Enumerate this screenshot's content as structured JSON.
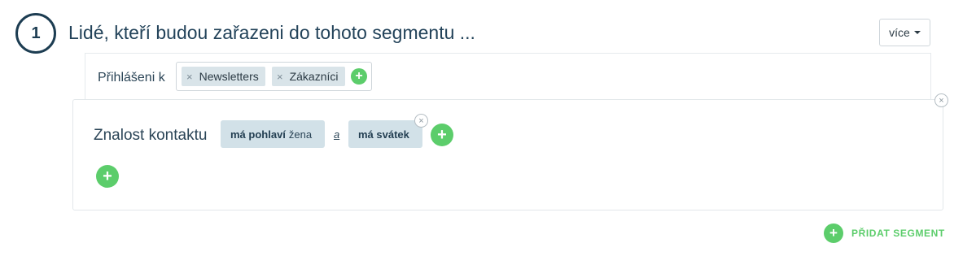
{
  "step": {
    "number": "1",
    "title": "Lidé, kteří budou zařazeni do tohoto segmentu ..."
  },
  "more_button": {
    "label": "více"
  },
  "subscription": {
    "label": "Přihlášeni k",
    "tags": [
      {
        "label": "Newsletters",
        "remove": "×"
      },
      {
        "label": "Zákazníci",
        "remove": "×"
      }
    ],
    "add": "+"
  },
  "condition": {
    "label": "Znalost kontaktu",
    "pills": [
      {
        "bold": "má pohlaví",
        "value": "žena"
      },
      {
        "bold": "má svátek",
        "value": ""
      }
    ],
    "conjunction": "a",
    "remove": "×",
    "add": "+",
    "add_row": "+",
    "close": "×"
  },
  "add_segment": {
    "icon": "+",
    "label": "PŘIDAT SEGMENT"
  },
  "colors": {
    "accent_green": "#5ccd6b",
    "primary_text": "#23435a",
    "pill_bg": "#d2e1e8",
    "tag_bg": "#d9e4e9"
  }
}
